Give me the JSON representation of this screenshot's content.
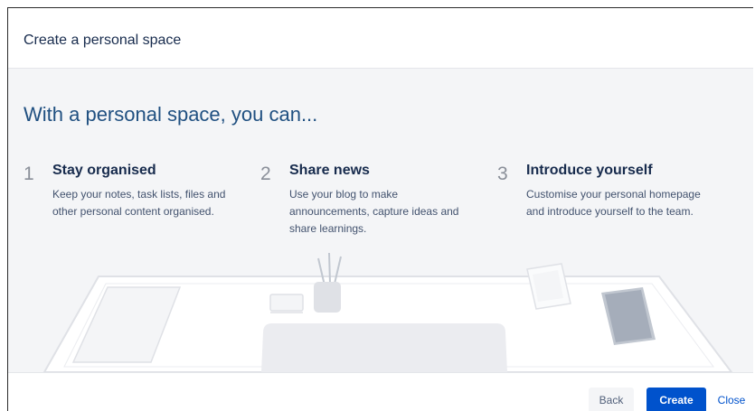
{
  "dialog": {
    "title": "Create a personal space"
  },
  "content": {
    "headline": "With a personal space, you can...",
    "features": [
      {
        "number": "1",
        "title": "Stay organised",
        "description": "Keep your notes, task lists, files and other personal content organised."
      },
      {
        "number": "2",
        "title": "Share news",
        "description": "Use your blog to make announcements, capture ideas and share learnings."
      },
      {
        "number": "3",
        "title": "Introduce yourself",
        "description": "Customise your personal homepage and introduce yourself to the team."
      }
    ],
    "illustration": "desk-illustration"
  },
  "footer": {
    "back_label": "Back",
    "create_label": "Create",
    "close_label": "Close"
  },
  "colors": {
    "primary": "#0052cc",
    "headline": "#205081",
    "content_background": "#f4f5f7"
  }
}
